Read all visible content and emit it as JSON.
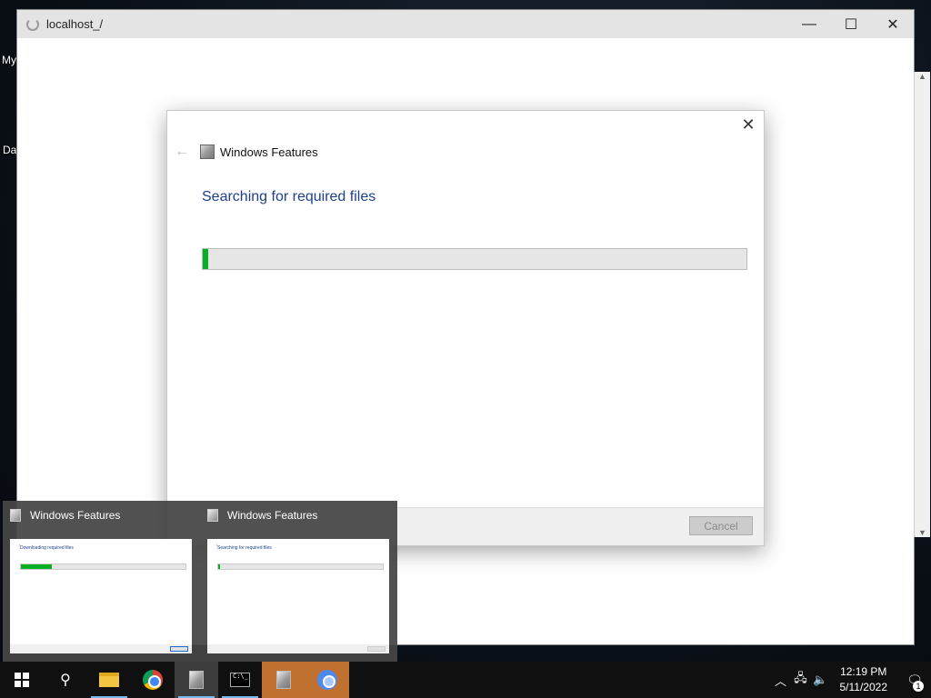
{
  "desktop": {
    "labels": [
      "My",
      "Da"
    ]
  },
  "window": {
    "title": "localhost_/",
    "controls": {
      "minimize": "—",
      "maximize": "☐",
      "close": "✕"
    }
  },
  "dialog": {
    "app_title": "Windows Features",
    "heading": "Searching for required files",
    "progress_percent": 1,
    "cancel_label": "Cancel"
  },
  "thumbnails": [
    {
      "title": "Windows Features",
      "mini_text": "Downloading required files",
      "progress_percent": 19
    },
    {
      "title": "Windows Features",
      "mini_text": "Searching for required files",
      "progress_percent": 1
    }
  ],
  "taskbar": {
    "items": [
      {
        "name": "start",
        "icon": "windows-logo-icon"
      },
      {
        "name": "search",
        "icon": "search-icon"
      },
      {
        "name": "file-explorer",
        "icon": "folder-icon"
      },
      {
        "name": "chrome",
        "icon": "chrome-icon"
      },
      {
        "name": "windows-features",
        "icon": "windows-features-icon"
      },
      {
        "name": "command-prompt",
        "icon": "cmd-icon"
      },
      {
        "name": "windows-features-2",
        "icon": "windows-features-icon"
      },
      {
        "name": "chrome-2",
        "icon": "chrome-icon"
      }
    ],
    "time": "12:19 PM",
    "date": "5/11/2022",
    "notification_count": "1"
  }
}
